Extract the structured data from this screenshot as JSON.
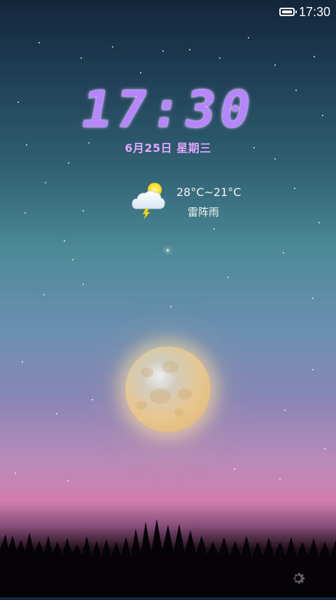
{
  "status_bar": {
    "battery_icon": "battery-icon",
    "time": "17:30"
  },
  "lockscreen": {
    "clock": "17:30",
    "date": "6月25日 星期三",
    "weather": {
      "icon": "thunderstorm-sun-icon",
      "temperature": "28°C~21°C",
      "condition": "雷阵雨"
    },
    "settings_icon": "gear-icon"
  },
  "colors": {
    "clock_accent": "#b685ff",
    "date_accent": "#e2a7ff"
  }
}
